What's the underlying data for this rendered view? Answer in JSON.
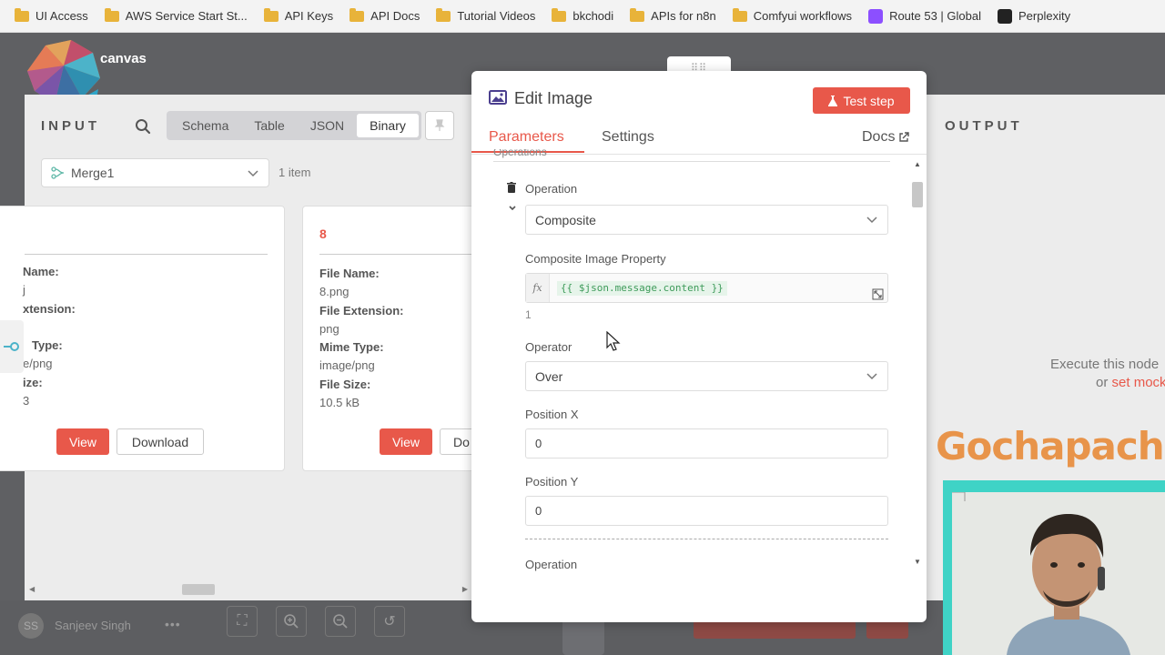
{
  "bookmarks": [
    {
      "label": "UI Access",
      "icon": "folder-icon"
    },
    {
      "label": "AWS Service Start St...",
      "icon": "folder-icon"
    },
    {
      "label": "API Keys",
      "icon": "folder-icon"
    },
    {
      "label": "API Docs",
      "icon": "folder-icon"
    },
    {
      "label": "Tutorial Videos",
      "icon": "folder-icon"
    },
    {
      "label": "bkchodi",
      "icon": "folder-icon"
    },
    {
      "label": "APIs for n8n",
      "icon": "folder-icon"
    },
    {
      "label": "Comfyui workflows",
      "icon": "folder-icon"
    },
    {
      "label": "Route 53 | Global",
      "icon": "route53-icon"
    },
    {
      "label": "Perplexity",
      "icon": "perplexity-icon"
    }
  ],
  "brand": {
    "text": "canvas"
  },
  "input": {
    "label": "INPUT",
    "view_tabs": [
      "Schema",
      "Table",
      "JSON",
      "Binary"
    ],
    "active_view": "Binary",
    "node_select": "Merge1",
    "items_count": "1 item",
    "cards": [
      {
        "number": "",
        "fields": [
          {
            "name": "Name:",
            "value": "j"
          },
          {
            "name": "xtension:",
            "value": ""
          },
          {
            "name": "Type:",
            "value": "e/png"
          },
          {
            "name": "ize:",
            "value": "3"
          }
        ],
        "view_label": "View",
        "download_label": "Download"
      },
      {
        "number": "8",
        "fields": [
          {
            "name": "File Name:",
            "value": "8.png"
          },
          {
            "name": "File Extension:",
            "value": "png"
          },
          {
            "name": "Mime Type:",
            "value": "image/png"
          },
          {
            "name": "File Size:",
            "value": "10.5 kB"
          }
        ],
        "view_label": "View",
        "download_label": "Do"
      }
    ]
  },
  "output": {
    "label": "OUTPUT",
    "exec_text": "Execute this node",
    "exec_or": "or",
    "exec_link": "set mock"
  },
  "modal": {
    "title": "Edit Image",
    "test_step_label": "Test step",
    "tabs": {
      "parameters": "Parameters",
      "settings": "Settings"
    },
    "docs_label": "Docs",
    "section_title": "Operations",
    "fields": {
      "operation_label": "Operation",
      "operation_value": "Composite",
      "composite_label": "Composite Image Property",
      "composite_expr": "{{ $json.message.content }}",
      "composite_result": "1",
      "operator_label": "Operator",
      "operator_value": "Over",
      "pos_x_label": "Position X",
      "pos_x_value": "0",
      "pos_y_label": "Position Y",
      "pos_y_value": "0",
      "next_operation_label": "Operation"
    }
  },
  "bottom": {
    "user_initials": "SS",
    "user_name": "Sanjeev Singh",
    "more": "•••"
  },
  "watermark": "Gochapachi",
  "colors": {
    "accent": "#e8584a",
    "watermark": "#e8944a",
    "cam_border": "#3fd3c6"
  }
}
